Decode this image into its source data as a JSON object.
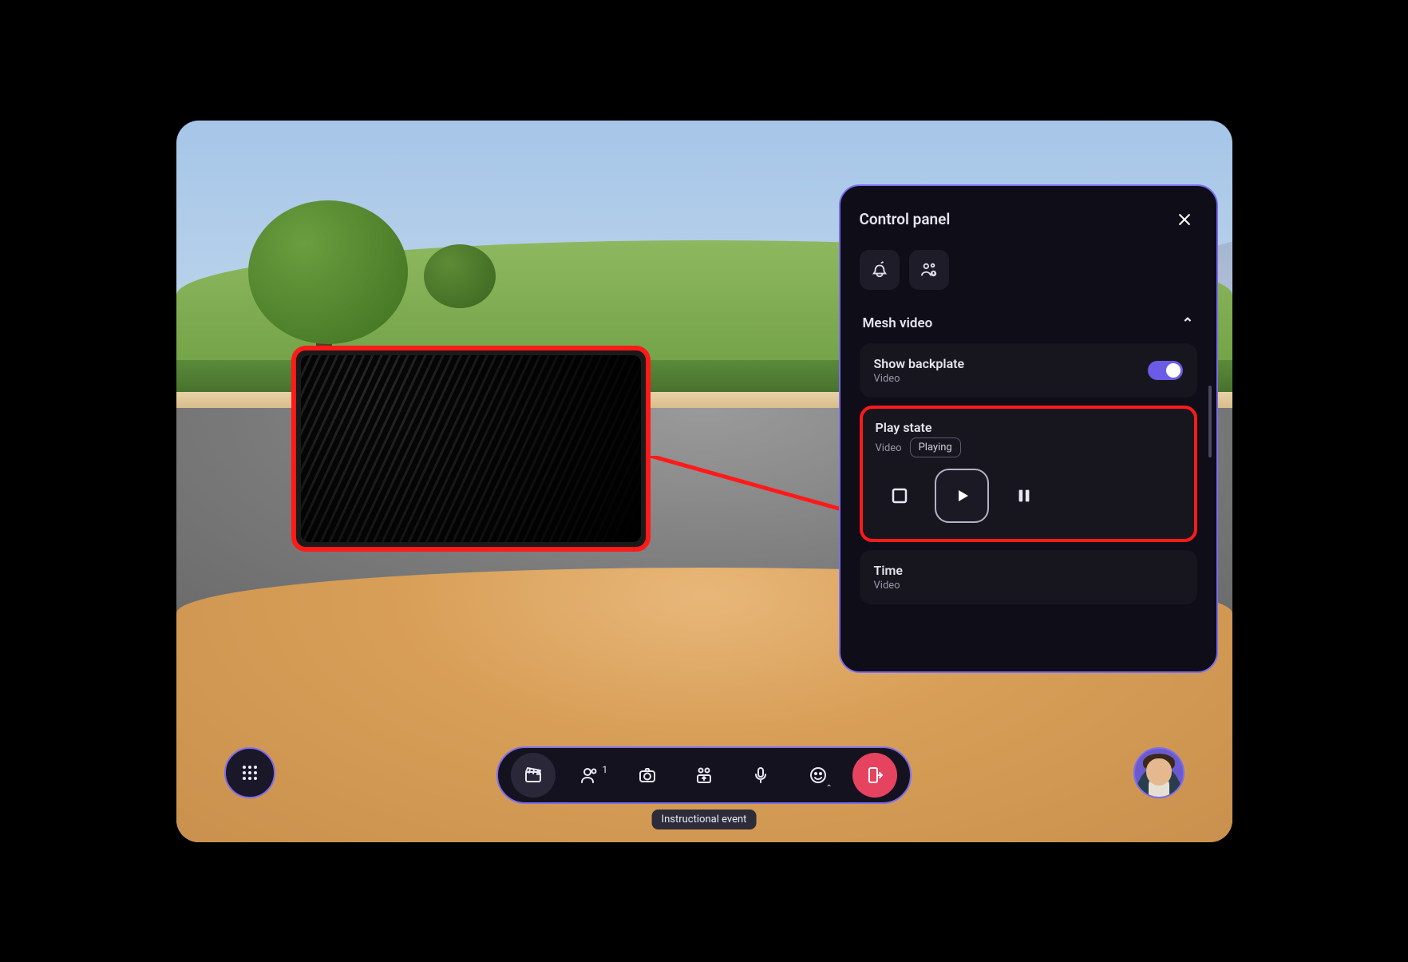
{
  "panel": {
    "title": "Control panel",
    "section_title": "Mesh video",
    "backplate": {
      "label": "Show backplate",
      "sublabel": "Video",
      "enabled": true
    },
    "playstate": {
      "label": "Play state",
      "sublabel": "Video",
      "status": "Playing"
    },
    "time": {
      "label": "Time",
      "sublabel": "Video"
    }
  },
  "toolbar": {
    "people_count": "1",
    "tooltip": "Instructional event"
  },
  "colors": {
    "accent": "#7b6cf0",
    "highlight": "#ff1a1a",
    "leave": "#e54360"
  }
}
